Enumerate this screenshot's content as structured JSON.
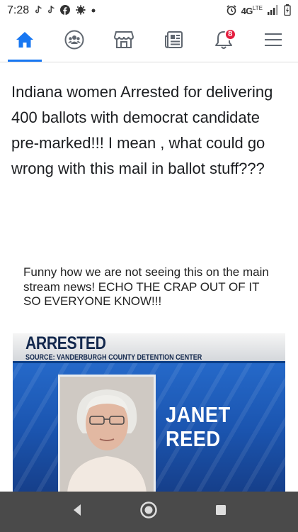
{
  "status_bar": {
    "time": "7:28",
    "network": "4G",
    "network_sub": "LTE",
    "left_icons": [
      "tiktok-icon",
      "tiktok-icon",
      "facebook-icon",
      "settings-icon",
      "dot-icon"
    ],
    "right_icons": [
      "alarm-icon",
      "signal-icon",
      "battery-icon"
    ]
  },
  "nav": {
    "items": [
      {
        "name": "home-icon",
        "active": true
      },
      {
        "name": "groups-icon",
        "active": false
      },
      {
        "name": "marketplace-icon",
        "active": false
      },
      {
        "name": "news-icon",
        "active": false
      },
      {
        "name": "notifications-icon",
        "active": false,
        "badge": "8"
      },
      {
        "name": "menu-icon",
        "active": false
      }
    ],
    "accent": "#1877f2",
    "badge_color": "#e41e3f"
  },
  "post": {
    "text": "Indiana women Arrested for delivering 400 ballots with democrat candidate pre-marked!!!  I mean , what could go wrong with this mail in ballot stuff???"
  },
  "image": {
    "caption": "Funny how we are not seeing this on the main stream news! ECHO THE CRAP OUT OF IT SO EVERYONE KNOW!!!",
    "banner_title": "ARRESTED",
    "banner_source": "SOURCE: VANDERBURGH COUNTY DETENTION CENTER",
    "name_line1": "JANET",
    "name_line2": "REED"
  },
  "android_nav": {
    "buttons": [
      "back-icon",
      "home-circle-icon",
      "recents-icon"
    ]
  }
}
